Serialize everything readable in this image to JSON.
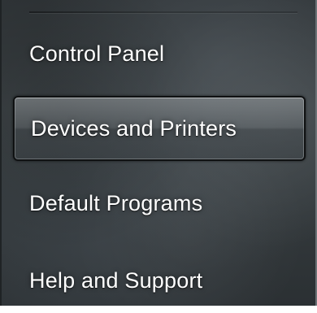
{
  "menu": {
    "items": [
      {
        "label": "Control Panel"
      },
      {
        "label": "Devices and Printers",
        "highlighted": true
      },
      {
        "label": "Default Programs"
      },
      {
        "label": "Help and Support"
      }
    ]
  }
}
